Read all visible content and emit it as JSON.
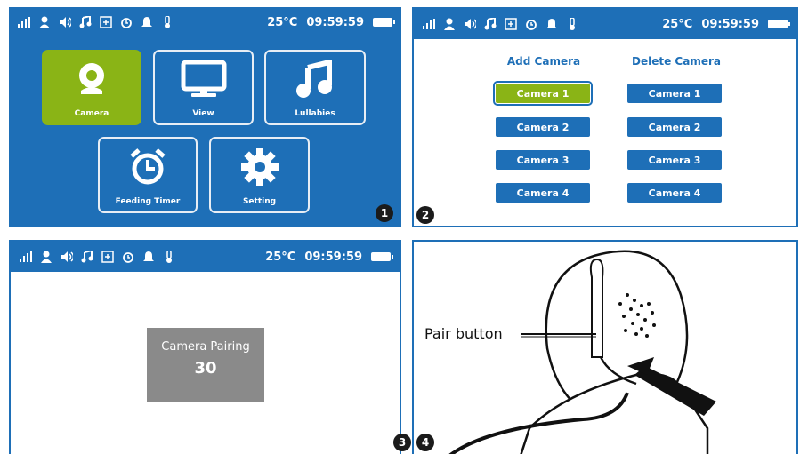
{
  "status": {
    "temperature": "25°C",
    "time": "09:59:59"
  },
  "panel1": {
    "badge": "1",
    "tiles": [
      {
        "label": "Camera",
        "icon": "camera-icon"
      },
      {
        "label": "View",
        "icon": "monitor-icon"
      },
      {
        "label": "Lullabies",
        "icon": "music-note-icon"
      },
      {
        "label": "Feeding Timer",
        "icon": "alarm-clock-icon"
      },
      {
        "label": "Setting",
        "icon": "gear-icon"
      }
    ]
  },
  "panel2": {
    "badge": "2",
    "add_header": "Add Camera",
    "delete_header": "Delete Camera",
    "add_cameras": [
      "Camera 1",
      "Camera 2",
      "Camera 3",
      "Camera 4"
    ],
    "delete_cameras": [
      "Camera 1",
      "Camera 2",
      "Camera 3",
      "Camera 4"
    ]
  },
  "panel3": {
    "badge": "3",
    "pairing_label": "Camera Pairing",
    "countdown": "30"
  },
  "panel4": {
    "badge": "4",
    "callout": "Pair button"
  },
  "colors": {
    "primary": "#1e6fb7",
    "selected": "#8ab416"
  }
}
